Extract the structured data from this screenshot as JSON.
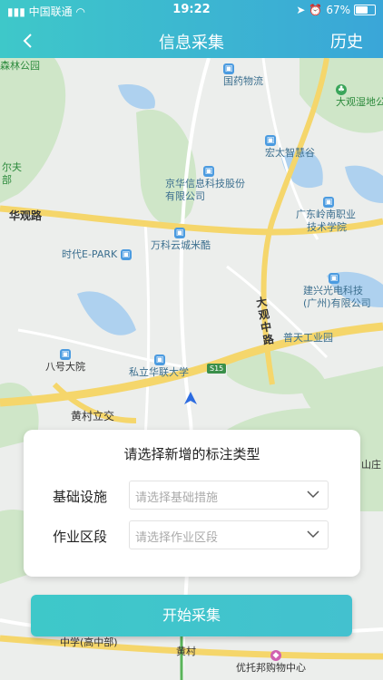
{
  "status_bar": {
    "carrier": "中国联通",
    "time": "19:22",
    "battery": "67%"
  },
  "nav": {
    "title": "信息采集",
    "history": "历史"
  },
  "map": {
    "pois": [
      {
        "name": "国药物流"
      },
      {
        "name": "大观湿地公"
      },
      {
        "name": "宏太智慧谷"
      },
      {
        "name": "京华信息科技股份"
      },
      {
        "name": "有限公司"
      },
      {
        "name": "广东岭南职业"
      },
      {
        "name": "技术学院"
      },
      {
        "name": "时代E-PARK"
      },
      {
        "name": "万科云城米酷"
      },
      {
        "name": "建兴光电科技"
      },
      {
        "name": "(广州)有限公司"
      },
      {
        "name": "普天工业园"
      },
      {
        "name": "八号大院"
      },
      {
        "name": "私立华联大学"
      },
      {
        "name": "黄村立交"
      },
      {
        "name": "森林公园"
      },
      {
        "name": "尔夫"
      },
      {
        "name": "部"
      },
      {
        "name": "中学(高中部)"
      },
      {
        "name": "黄村"
      },
      {
        "name": "优托邦购物中心"
      },
      {
        "name": "山庄"
      }
    ],
    "roads": {
      "huaguan": "华观路",
      "daguan": "大观中路",
      "shield": "S15"
    }
  },
  "form": {
    "heading": "请选择新增的标注类型",
    "rows": [
      {
        "label": "基础设施",
        "placeholder": "请选择基础措施"
      },
      {
        "label": "作业区段",
        "placeholder": "请选择作业区段"
      }
    ]
  },
  "start_button": "开始采集",
  "colors": {
    "accent": "#3ec8c9",
    "accent2": "#3aa6d8",
    "road": "#f5d66b"
  }
}
